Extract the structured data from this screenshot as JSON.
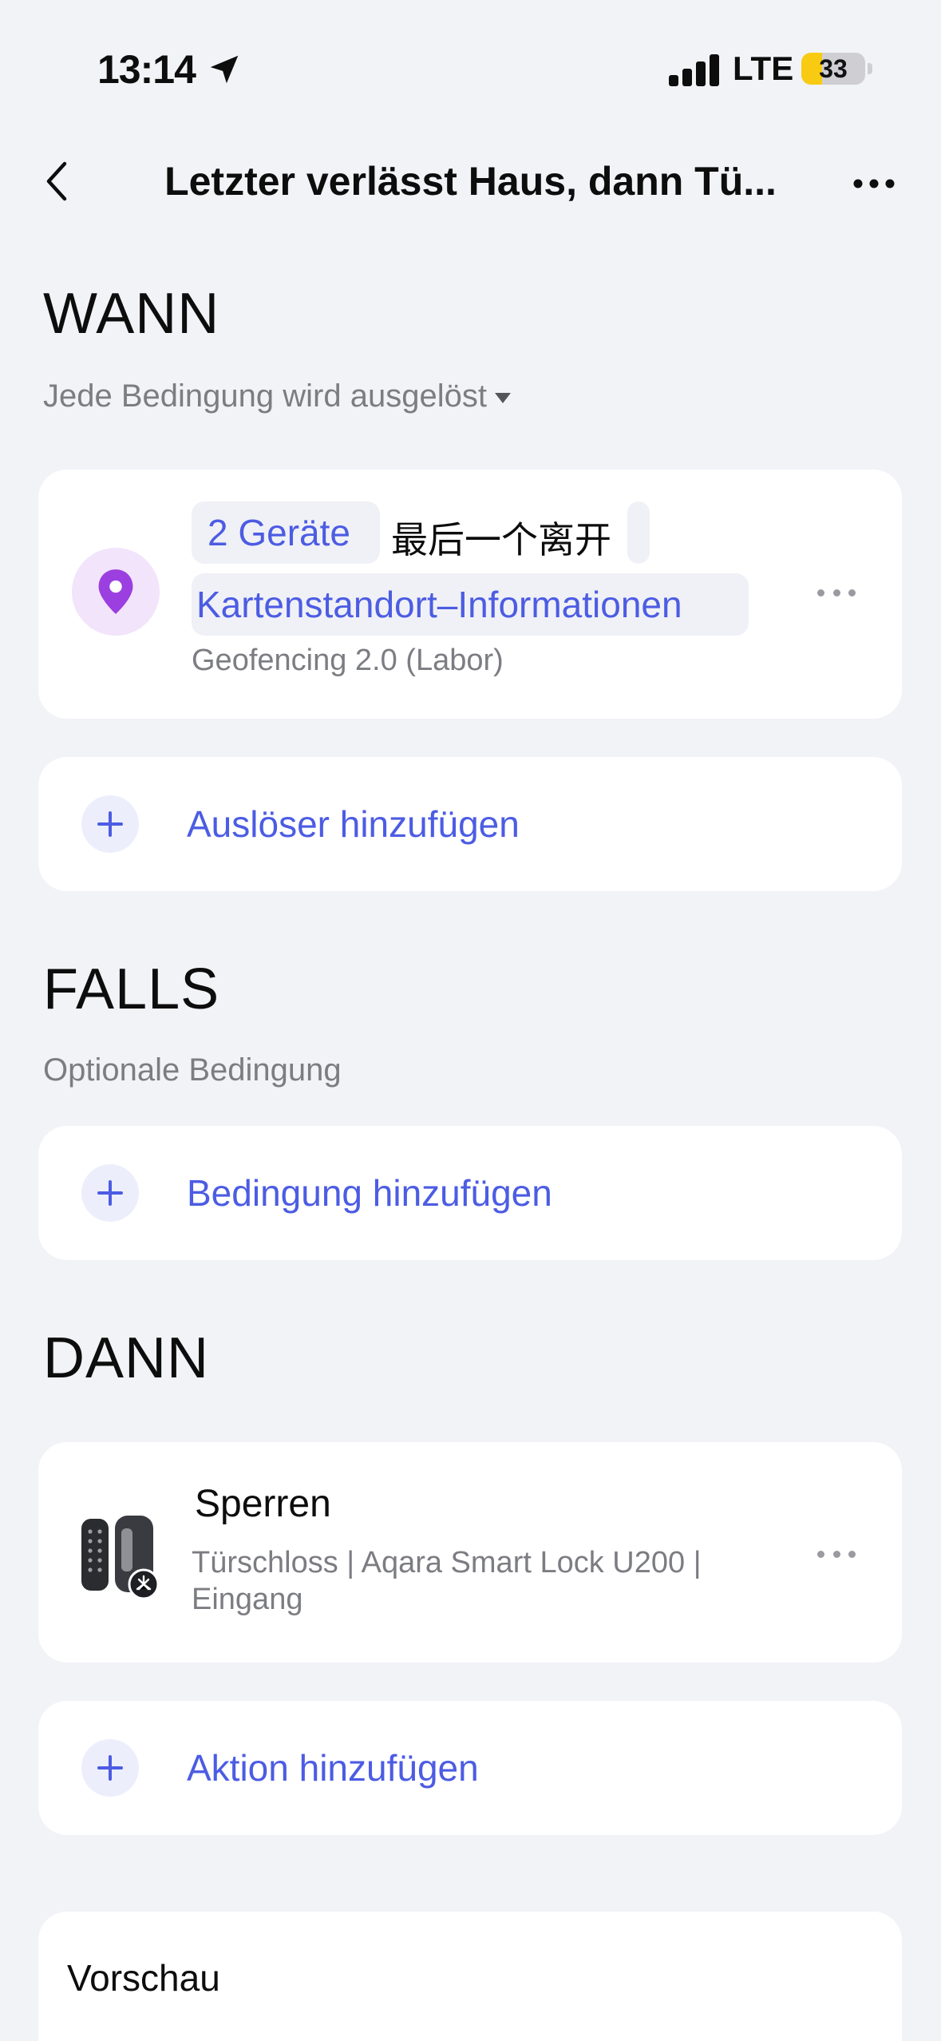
{
  "status_bar": {
    "time": "13:14",
    "network": "LTE",
    "battery": "33",
    "battery_level": 0.33,
    "battery_color": "#F8CB12"
  },
  "nav": {
    "title": "Letzter verlässt Haus, dann Tü..."
  },
  "when": {
    "title": "WANN",
    "subtitle": "Jede Bedingung wird ausgelöst",
    "trigger": {
      "icon": "location-pin-icon",
      "devices_chip": "2 Geräte",
      "condition_text": "最后一个离开",
      "location_chip": "Kartenstandort–Informationen",
      "source_label": "Geofencing 2.0 (Labor)"
    },
    "add_label": "Auslöser hinzufügen"
  },
  "if": {
    "title": "FALLS",
    "subtitle": "Optionale Bedingung",
    "add_label": "Bedingung hinzufügen"
  },
  "then": {
    "title": "DANN",
    "action": {
      "icon": "smart-lock-icon",
      "title": "Sperren",
      "subtitle": "Türschloss | Aqara Smart Lock U200 | Eingang"
    },
    "add_label": "Aktion hinzufügen"
  },
  "preview": {
    "label": "Vorschau"
  },
  "colors": {
    "accent": "#4C5CE3",
    "background": "#F2F3F7",
    "pin": "#9B3FE0"
  }
}
